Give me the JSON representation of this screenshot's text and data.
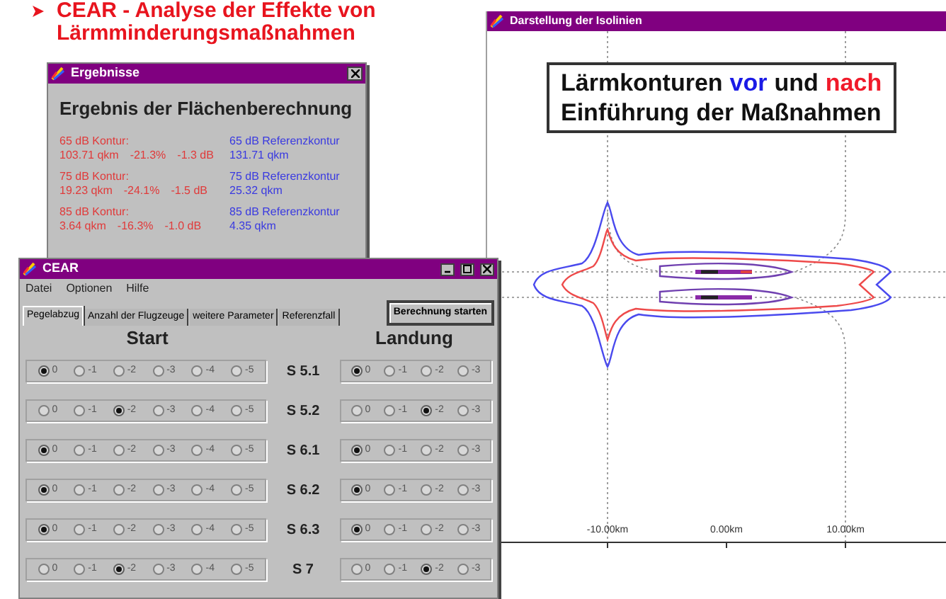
{
  "slide_title": [
    "CEAR - Analyse der Effekte von",
    "Lärmminderungsmaßnahmen"
  ],
  "results_window": {
    "title": "Ergebnisse",
    "heading": "Ergebnis der Flächenberechnung",
    "rows": [
      {
        "left": {
          "color": "#e03a3a",
          "title": "65 dB Kontur:",
          "values": [
            "103.71 qkm",
            "-21.3%",
            "-1.3 dB"
          ]
        },
        "right": {
          "color": "#3a3ae0",
          "title": "65 dB Referenzkontur",
          "values": [
            "131.71 qkm"
          ]
        }
      },
      {
        "left": {
          "color": "#e03a3a",
          "title": "75 dB Kontur:",
          "values": [
            "19.23 qkm",
            "-24.1%",
            "-1.5 dB"
          ]
        },
        "right": {
          "color": "#3a3ae0",
          "title": "75 dB Referenzkontur",
          "values": [
            "25.32 qkm"
          ]
        }
      },
      {
        "left": {
          "color": "#e03a3a",
          "title": "85 dB Kontur:",
          "values": [
            "3.64 qkm",
            "-16.3%",
            "-1.0 dB"
          ]
        },
        "right": {
          "color": "#3a3ae0",
          "title": "85 dB Referenzkontur",
          "values": [
            "4.35 qkm"
          ]
        }
      }
    ]
  },
  "main_window": {
    "title": "CEAR",
    "menu": [
      "Datei",
      "Optionen",
      "Hilfe"
    ],
    "tabs": [
      {
        "label": "Pegelabzug",
        "selected": true
      },
      {
        "label": "Anzahl der Flugzeuge",
        "selected": false
      },
      {
        "label": "weitere Parameter",
        "selected": false
      },
      {
        "label": "Referenzfall",
        "selected": false
      }
    ],
    "button": "Berechnung starten",
    "start_header": "Start",
    "landing_header": "Landung",
    "rows": [
      {
        "label": "S 5.1",
        "start": [
          {
            "label": "0",
            "selected": true
          },
          {
            "label": "-1",
            "selected": false
          },
          {
            "label": "-2",
            "selected": false
          },
          {
            "label": "-3",
            "selected": false
          },
          {
            "label": "-4",
            "selected": false
          },
          {
            "label": "-5",
            "selected": false
          }
        ],
        "landing": [
          {
            "label": "0",
            "selected": true
          },
          {
            "label": "-1",
            "selected": false
          },
          {
            "label": "-2",
            "selected": false
          },
          {
            "label": "-3",
            "selected": false
          }
        ]
      },
      {
        "label": "S 5.2",
        "start": [
          {
            "label": "0",
            "selected": false
          },
          {
            "label": "-1",
            "selected": false
          },
          {
            "label": "-2",
            "selected": true
          },
          {
            "label": "-3",
            "selected": false
          },
          {
            "label": "-4",
            "selected": false
          },
          {
            "label": "-5",
            "selected": false
          }
        ],
        "landing": [
          {
            "label": "0",
            "selected": false
          },
          {
            "label": "-1",
            "selected": false
          },
          {
            "label": "-2",
            "selected": true
          },
          {
            "label": "-3",
            "selected": false
          }
        ]
      },
      {
        "label": "S 6.1",
        "start": [
          {
            "label": "0",
            "selected": true
          },
          {
            "label": "-1",
            "selected": false
          },
          {
            "label": "-2",
            "selected": false
          },
          {
            "label": "-3",
            "selected": false
          },
          {
            "label": "-4",
            "selected": false
          },
          {
            "label": "-5",
            "selected": false
          }
        ],
        "landing": [
          {
            "label": "0",
            "selected": true
          },
          {
            "label": "-1",
            "selected": false
          },
          {
            "label": "-2",
            "selected": false
          },
          {
            "label": "-3",
            "selected": false
          }
        ]
      },
      {
        "label": "S 6.2",
        "start": [
          {
            "label": "0",
            "selected": true
          },
          {
            "label": "-1",
            "selected": false
          },
          {
            "label": "-2",
            "selected": false
          },
          {
            "label": "-3",
            "selected": false
          },
          {
            "label": "-4",
            "selected": false
          },
          {
            "label": "-5",
            "selected": false
          }
        ],
        "landing": [
          {
            "label": "0",
            "selected": true
          },
          {
            "label": "-1",
            "selected": false
          },
          {
            "label": "-2",
            "selected": false
          },
          {
            "label": "-3",
            "selected": false
          }
        ]
      },
      {
        "label": "S 6.3",
        "start": [
          {
            "label": "0",
            "selected": true
          },
          {
            "label": "-1",
            "selected": false
          },
          {
            "label": "-2",
            "selected": false
          },
          {
            "label": "-3",
            "selected": false
          },
          {
            "label": "-4",
            "selected": false
          },
          {
            "label": "-5",
            "selected": false
          }
        ],
        "landing": [
          {
            "label": "0",
            "selected": true
          },
          {
            "label": "-1",
            "selected": false
          },
          {
            "label": "-2",
            "selected": false
          },
          {
            "label": "-3",
            "selected": false
          }
        ]
      },
      {
        "label": "S 7",
        "start": [
          {
            "label": "0",
            "selected": false
          },
          {
            "label": "-1",
            "selected": false
          },
          {
            "label": "-2",
            "selected": true
          },
          {
            "label": "-3",
            "selected": false
          },
          {
            "label": "-4",
            "selected": false
          },
          {
            "label": "-5",
            "selected": false
          }
        ],
        "landing": [
          {
            "label": "0",
            "selected": false
          },
          {
            "label": "-1",
            "selected": false
          },
          {
            "label": "-2",
            "selected": true
          },
          {
            "label": "-3",
            "selected": false
          }
        ]
      }
    ]
  },
  "plot_window": {
    "title": "Darstellung der Isolinien",
    "x_axis_labels": [
      "-10.00km",
      "0.00km",
      "10.00km"
    ]
  },
  "annotation": {
    "lines": [
      [
        {
          "text": "Lärmkonturen",
          "color": "#111111"
        },
        {
          "text": "vor",
          "color": "#1a1ae6"
        },
        {
          "text": "und",
          "color": "#111111"
        },
        {
          "text": "nach",
          "color": "#f01a2a"
        }
      ],
      [
        {
          "text": "Einführung",
          "color": "#111111"
        },
        {
          "text": "der",
          "color": "#111111"
        },
        {
          "text": "Maßnahmen",
          "color": "#111111"
        }
      ]
    ]
  }
}
